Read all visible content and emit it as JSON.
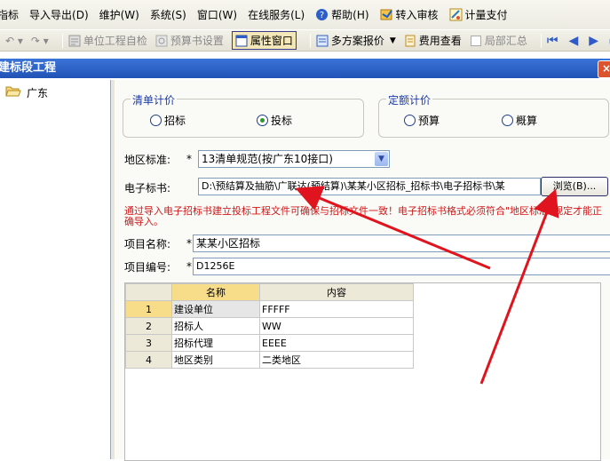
{
  "menu": {
    "items": [
      "指标",
      "导入导出(D)",
      "维护(W)",
      "系统(S)",
      "窗口(W)",
      "在线服务(L)",
      "帮助(H)",
      "转入审核",
      "计量支付"
    ]
  },
  "toolbar": {
    "undo": "↶ ▾",
    "redo": "↷ ▾",
    "unit_check": "单位工程自检",
    "book_setting": "预算书设置",
    "attr_window": "属性窗口",
    "multi_quote": "多方案报价",
    "fee_view": "费用查看",
    "local_sum": "局部汇总"
  },
  "window": {
    "title": "建标段工程",
    "close": "×"
  },
  "tree": {
    "root": "广东"
  },
  "form": {
    "bill_pricing": {
      "title": "清单计价",
      "options": [
        "招标",
        "投标"
      ],
      "selected": "投标"
    },
    "quota_pricing": {
      "title": "定额计价",
      "options": [
        "预算",
        "概算"
      ],
      "selected": ""
    },
    "region_label": "地区标准:",
    "required_mark": "*",
    "region_value": "13清单规范(按广东10接口)",
    "ebook_label": "电子标书:",
    "ebook_value": "D:\\预结算及抽筋\\广联达(预结算)\\某某小区招标_招标书\\电子招标书\\某",
    "browse_label": "浏览(B)...",
    "warning": "通过导入电子招标书建立投标工程文件可确保与招标文件一致！电子招标书格式必须符合\"地区标准\"规定才能正确导入。",
    "project_name_label": "项目名称:",
    "project_name_value": "某某小区招标",
    "project_code_label": "项目编号:",
    "project_code_value": "D1256E"
  },
  "grid": {
    "headers": [
      "名称",
      "内容"
    ],
    "rows": [
      {
        "no": "1",
        "name": "建设单位",
        "content": "FFFFF"
      },
      {
        "no": "2",
        "name": "招标人",
        "content": "WW"
      },
      {
        "no": "3",
        "name": "招标代理",
        "content": "EEEE"
      },
      {
        "no": "4",
        "name": "地区类别",
        "content": "二类地区"
      }
    ]
  },
  "colors": {
    "titlebar": "#2a5fc6",
    "warning_text": "#d01818",
    "annotation_arrow": "#e0141e",
    "group_title": "#1a3aa8"
  }
}
